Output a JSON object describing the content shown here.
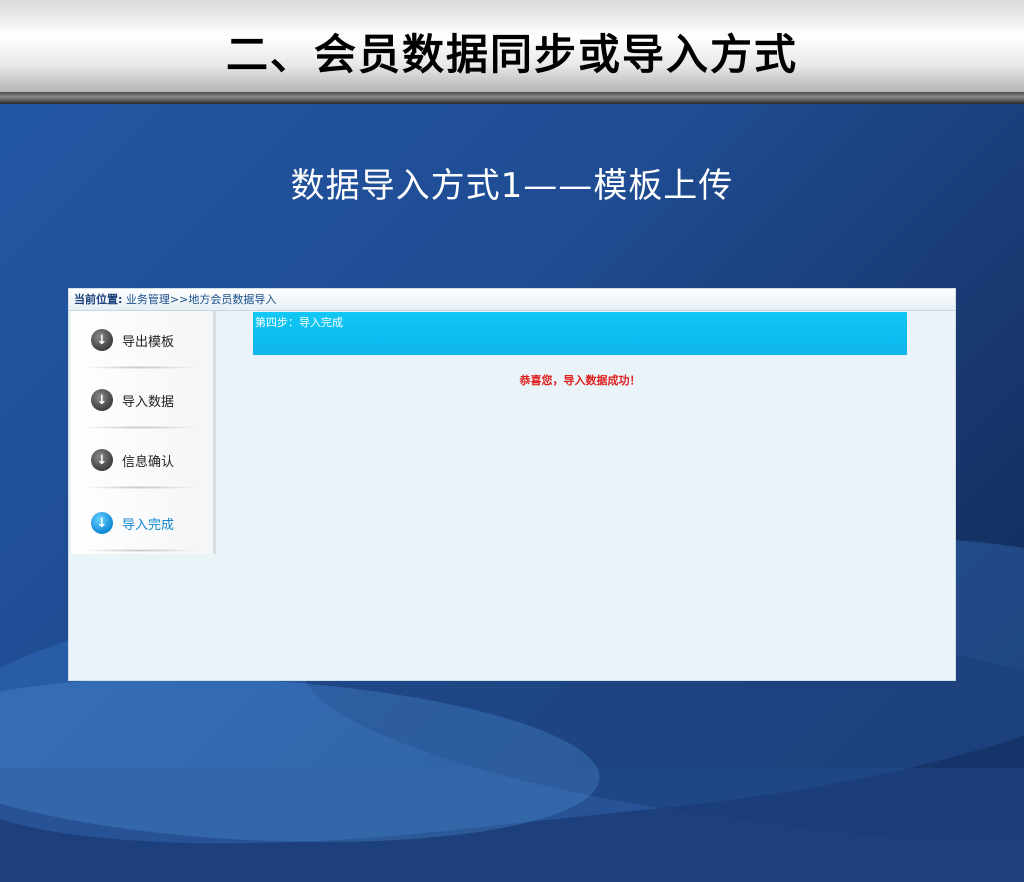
{
  "slide": {
    "title": "二、会员数据同步或导入方式",
    "subtitle_main": "数据导入方式1——",
    "subtitle_tail": "模板上传"
  },
  "app": {
    "breadcrumb": {
      "label": "当前位置:",
      "path": "业务管理>>地方会员数据导入"
    },
    "steps": [
      {
        "label": "导出模板",
        "icon": "arrow-down-circle-icon",
        "active": false
      },
      {
        "label": "导入数据",
        "icon": "arrow-down-circle-icon",
        "active": false
      },
      {
        "label": "信息确认",
        "icon": "arrow-down-circle-icon",
        "active": false
      },
      {
        "label": "导入完成",
        "icon": "arrow-down-circle-icon",
        "active": true
      }
    ],
    "banner_text": "第四步：导入完成",
    "success_message": "恭喜您，导入数据成功！"
  },
  "colors": {
    "banner": "#0bbcf0",
    "success_text": "#e0201e",
    "active_step": "#1287cf"
  }
}
